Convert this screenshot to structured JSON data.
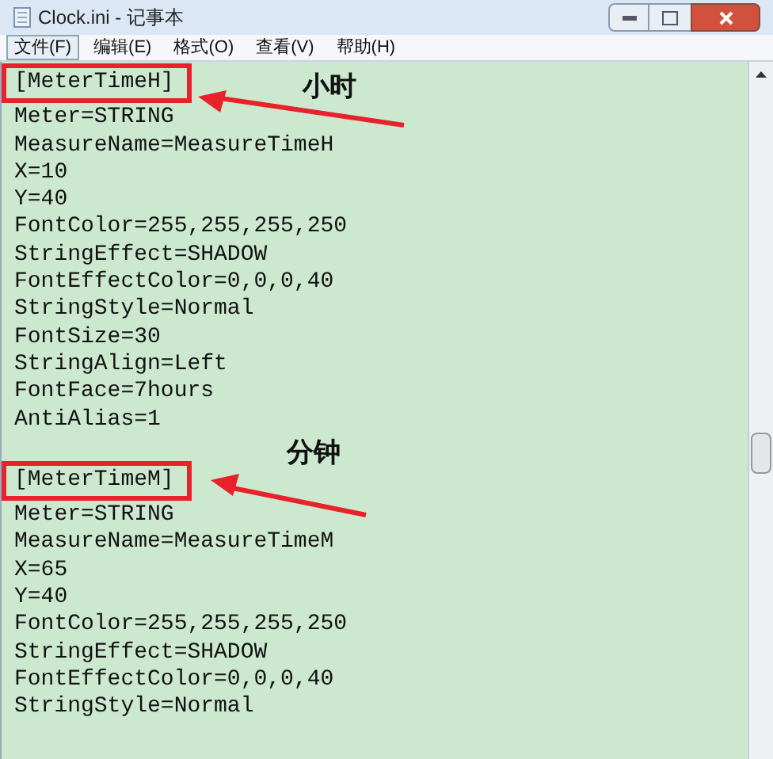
{
  "window": {
    "title": "Clock.ini - 记事本"
  },
  "menu": [
    {
      "label": "文件(F)",
      "selected": true
    },
    {
      "label": "编辑(E)",
      "selected": false
    },
    {
      "label": "格式(O)",
      "selected": false
    },
    {
      "label": "查看(V)",
      "selected": false
    },
    {
      "label": "帮助(H)",
      "selected": false
    }
  ],
  "sections": [
    {
      "annotation": "小时",
      "lines": [
        "[MeterTimeH]",
        "Meter=STRING",
        "MeasureName=MeasureTimeH",
        "X=10",
        "Y=40",
        "FontColor=255,255,255,250",
        "StringEffect=SHADOW",
        "FontEffectColor=0,0,0,40",
        "StringStyle=Normal",
        "FontSize=30",
        "StringAlign=Left",
        "FontFace=7hours",
        "AntiAlias=1"
      ]
    },
    {
      "annotation": "分钟",
      "lines": [
        "[MeterTimeM]",
        "Meter=STRING",
        "MeasureName=MeasureTimeM",
        "X=65",
        "Y=40",
        "FontColor=255,255,255,250",
        "StringEffect=SHADOW",
        "FontEffectColor=0,0,0,40",
        "StringStyle=Normal"
      ]
    }
  ]
}
